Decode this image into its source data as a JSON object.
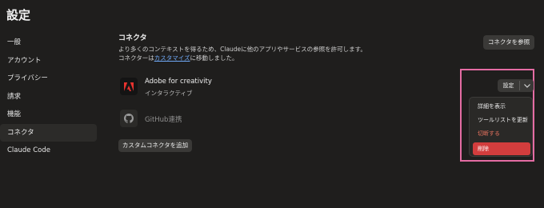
{
  "window": {
    "title": "設定"
  },
  "sidebar": {
    "items": [
      {
        "label": "一般"
      },
      {
        "label": "アカウント"
      },
      {
        "label": "プライバシー"
      },
      {
        "label": "請求"
      },
      {
        "label": "機能"
      },
      {
        "label": "コネクタ",
        "active": true
      },
      {
        "label": "Claude Code"
      }
    ]
  },
  "connectors": {
    "title": "コネクタ",
    "description_line1": "より多くのコンテキストを得るため、Claudeに他のアプリやサービスの参照を許可します。",
    "description_line2_pre": "コネクターは",
    "description_line2_link": "カスタマイズ",
    "description_line2_post": "に移動しました。",
    "browse_button": "コネクタを参照",
    "adobe": {
      "name": "Adobe for creativity",
      "subtitle": "インタラクティブ",
      "icon": "adobe-icon"
    },
    "github": {
      "name": "GitHub連携",
      "icon": "github-icon"
    },
    "add_button": "カスタムコネクタを追加"
  },
  "settings_split_button": {
    "label": "設定",
    "chevron_icon": "chevron-down-icon"
  },
  "dropdown_menu": {
    "items": [
      {
        "label": "詳細を表示"
      },
      {
        "label": "ツールリストを更新"
      },
      {
        "label": "切断する"
      },
      {
        "label": "削除"
      }
    ]
  },
  "colors": {
    "background": "#1f1e1d",
    "link": "#6fa8f5",
    "highlight_border": "#e46ca3",
    "danger": "#d23d3d",
    "warning_text": "#e8735f",
    "adobe_red": "#e8322e"
  }
}
